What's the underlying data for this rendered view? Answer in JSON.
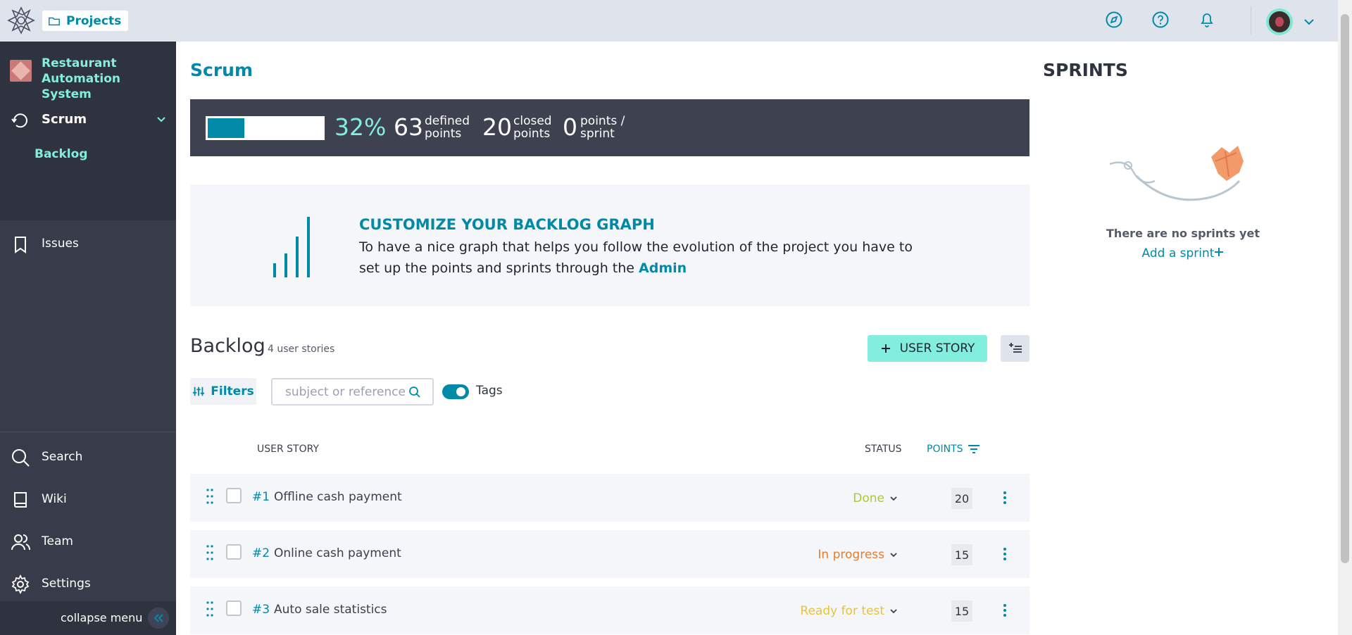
{
  "topbar": {
    "projects_label": "Projects"
  },
  "sidebar": {
    "project_name": "Restaurant Automation System",
    "scrum_label": "Scrum",
    "backlog_label": "Backlog",
    "issues_label": "Issues",
    "search_label": "Search",
    "wiki_label": "Wiki",
    "team_label": "Team",
    "settings_label": "Settings",
    "collapse_label": "collapse menu"
  },
  "main": {
    "title": "Scrum",
    "stats": {
      "progress_fraction": 0.32,
      "percent": "32%",
      "defined_value": "63",
      "defined_line1": "defined",
      "defined_line2": "points",
      "closed_value": "20",
      "closed_line1": "closed",
      "closed_line2": "points",
      "sprint_value": "0",
      "sprint_line1": "points /",
      "sprint_line2": "sprint"
    },
    "graph": {
      "title": "CUSTOMIZE YOUR BACKLOG GRAPH",
      "text": "To have a nice graph that helps you follow the evolution of the project you have to set up the points and sprints through the",
      "link": "Admin"
    },
    "backlog": {
      "title": "Backlog",
      "count": "4 user stories",
      "add_label": "USER STORY",
      "filters_label": "Filters",
      "search_placeholder": "subject or reference",
      "tags_label": "Tags",
      "col_user_story": "USER STORY",
      "col_status": "STATUS",
      "col_points": "POINTS",
      "rows": [
        {
          "ref": "#1",
          "subject": "Offline cash payment",
          "status": "Done",
          "points": "20"
        },
        {
          "ref": "#2",
          "subject": "Online cash payment",
          "status": "In progress",
          "points": "15"
        },
        {
          "ref": "#3",
          "subject": "Auto sale statistics",
          "status": "Ready for test",
          "points": "15"
        }
      ]
    }
  },
  "sprints": {
    "title": "SPRINTS",
    "empty_text": "There are no sprints yet",
    "add_label": "Add a sprint"
  },
  "colors": {
    "accent": "#008aa8",
    "mint": "#83eede",
    "status_done": "#a8c93a",
    "status_in_progress": "#e47c2e",
    "status_ready_for_test": "#e8c23d"
  }
}
